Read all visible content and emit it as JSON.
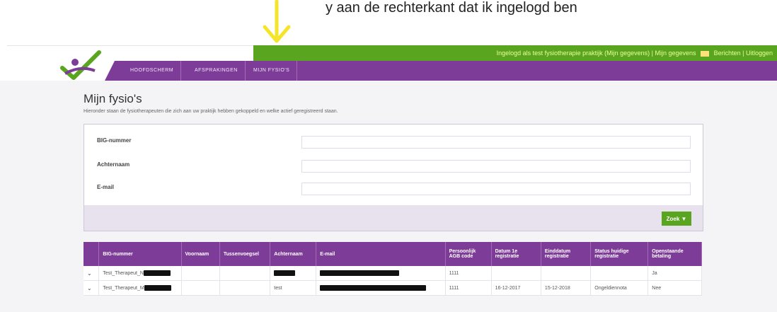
{
  "caption": "y aan de rechterkant dat ik ingelogd ben",
  "header": {
    "login_text": "Ingelogd als test fysiotherapie praktijk (Mijn gegevens) | Mijn gegevens",
    "messages_label": "Berichten",
    "logout_label": "Uitloggen"
  },
  "nav": [
    {
      "label": "Hoofdscherm"
    },
    {
      "label": "Afsprakingen"
    },
    {
      "label": "Mijn fysio's"
    }
  ],
  "page": {
    "title": "Mijn fysio's",
    "subtitle": "Hieronder staan de fysiotherapeuten die zich aan uw praktijk hebben gekoppeld en welke actief geregistreerd staan."
  },
  "filters": [
    {
      "label": "BIG-nummer",
      "value": ""
    },
    {
      "label": "Achternaam",
      "value": ""
    },
    {
      "label": "E-mail",
      "value": ""
    }
  ],
  "search_button": "Zoek ▼",
  "table": {
    "columns": [
      "BIG-nummer",
      "Voornaam",
      "Tussenvoegsel",
      "Achternaam",
      "E-mail",
      "Persoonlijk AGB code",
      "Datum 1e registratie",
      "Einddatum registratie",
      "Status huidige registratie",
      "Openstaande betaling"
    ],
    "rows": [
      {
        "big": "Test_Therapeut_N",
        "voornaam": "",
        "tussenvoegsel": "",
        "achternaam": "",
        "email": "",
        "agb": "1111",
        "datum1": "",
        "einddatum": "",
        "status": "",
        "betaling": "Ja"
      },
      {
        "big": "Test_Therapeut_M",
        "voornaam": "",
        "tussenvoegsel": "",
        "achternaam": "test",
        "email": "",
        "agb": "1111",
        "datum1": "16-12-2017",
        "einddatum": "15-12-2018",
        "status": "Ongeldiennota",
        "betaling": "Nee"
      }
    ]
  },
  "colors": {
    "accent_purple": "#7d3c98",
    "accent_green": "#5aa51f",
    "arrow_yellow": "#f5e52a"
  }
}
